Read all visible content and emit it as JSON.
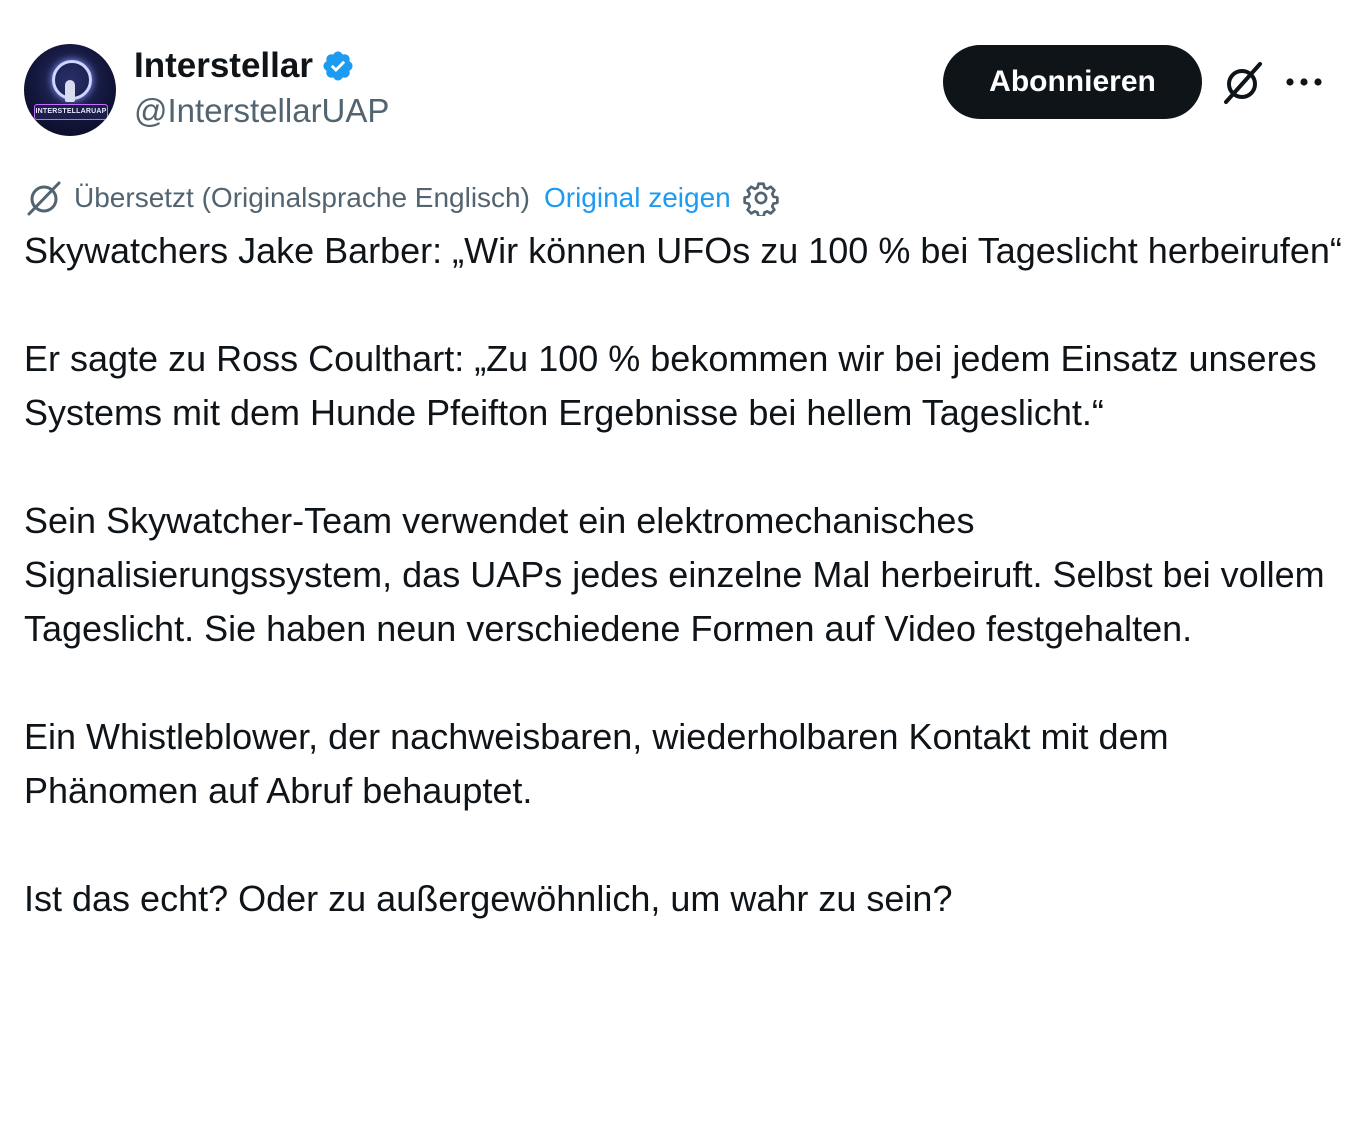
{
  "author": {
    "name": "Interstellar",
    "handle": "@InterstellarUAP",
    "avatar_text": "INTERSTELLARUAP",
    "verified": true
  },
  "actions": {
    "subscribe_label": "Abonnieren",
    "grok_icon": "grok-icon",
    "more_icon": "more-icon"
  },
  "translation": {
    "note": "Übersetzt (Originalsprache Englisch)",
    "show_original_label": "Original zeigen"
  },
  "post": {
    "paragraphs": [
      "Skywatchers Jake Barber: „Wir können UFOs zu 100 % bei Tageslicht herbeirufen“",
      "Er sagte zu Ross Coulthart: „Zu 100 % bekommen wir bei jedem Einsatz unseres Systems mit dem Hunde Pfeifton Ergebnisse bei hellem Tageslicht.“",
      "Sein Skywatcher-Team verwendet ein elektromechanisches Signalisierungssystem, das UAPs jedes einzelne Mal herbeiruft. Selbst bei vollem Tageslicht. Sie haben neun verschiedene Formen auf Video festgehalten.",
      "Ein Whistleblower, der nachweisbaren, wiederholbaren Kontakt mit dem Phänomen auf Abruf behauptet.",
      "Ist das echt? Oder zu außergewöhnlich, um wahr zu sein?"
    ]
  },
  "colors": {
    "text": "#0f1419",
    "secondary": "#536471",
    "link": "#1d9bf0",
    "button_bg": "#0f1419"
  }
}
